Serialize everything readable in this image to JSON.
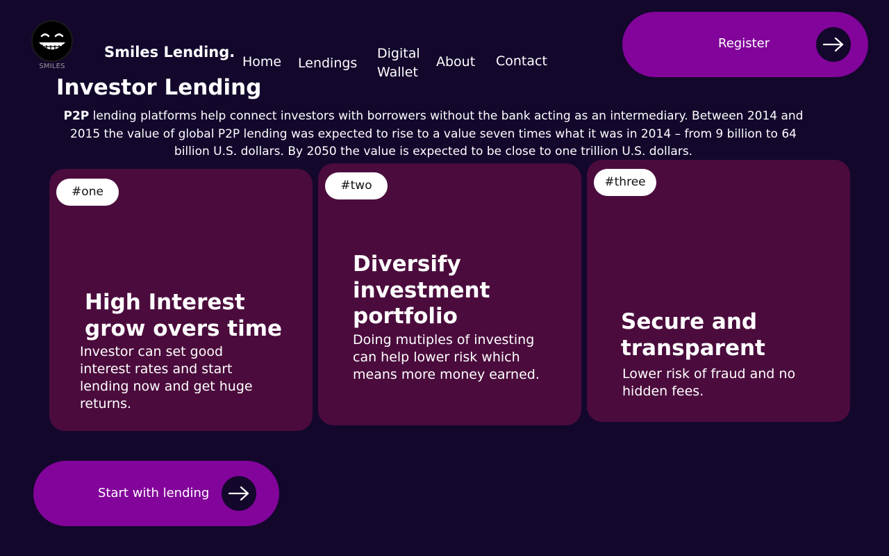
{
  "logo": {
    "text": "SMILES",
    "icon": "smiley-face-icon"
  },
  "brand": "Smiles Lending.",
  "nav": {
    "home": "Home",
    "lendings": "Lendings",
    "digital_wallet": "Digital Wallet",
    "about": "About",
    "contact": "Contact"
  },
  "register": {
    "label": "Register",
    "icon": "arrow-right-icon"
  },
  "hero": {
    "title": "Investor Lending",
    "intro_bold": "P2P",
    "intro_text": " lending platforms help connect investors with borrowers without the bank acting as an intermediary. Between 2014 and 2015 the value of global P2P lending was expected to rise to a value seven times what it was in 2014 – from 9 billion to 64 billion U.S. dollars. By 2050 the value is expected to be close to one trillion U.S. dollars."
  },
  "cards": [
    {
      "tag": "#one",
      "title": "High Interest grow overs time",
      "text": "Investor can set good interest rates and start lending now and  get huge returns."
    },
    {
      "tag": "#two",
      "title": "Diversify investment portfolio",
      "text": "Doing mutiples of investing can help lower risk which  means more money earned."
    },
    {
      "tag": "#three",
      "title": "Secure and transparent",
      "text": "Lower risk of fraud and no hidden fees."
    }
  ],
  "start_button": {
    "label": "Start with lending",
    "icon": "arrow-right-icon"
  },
  "colors": {
    "background": "#13072c",
    "accent": "#82049a",
    "card": "#4b0c3d"
  }
}
